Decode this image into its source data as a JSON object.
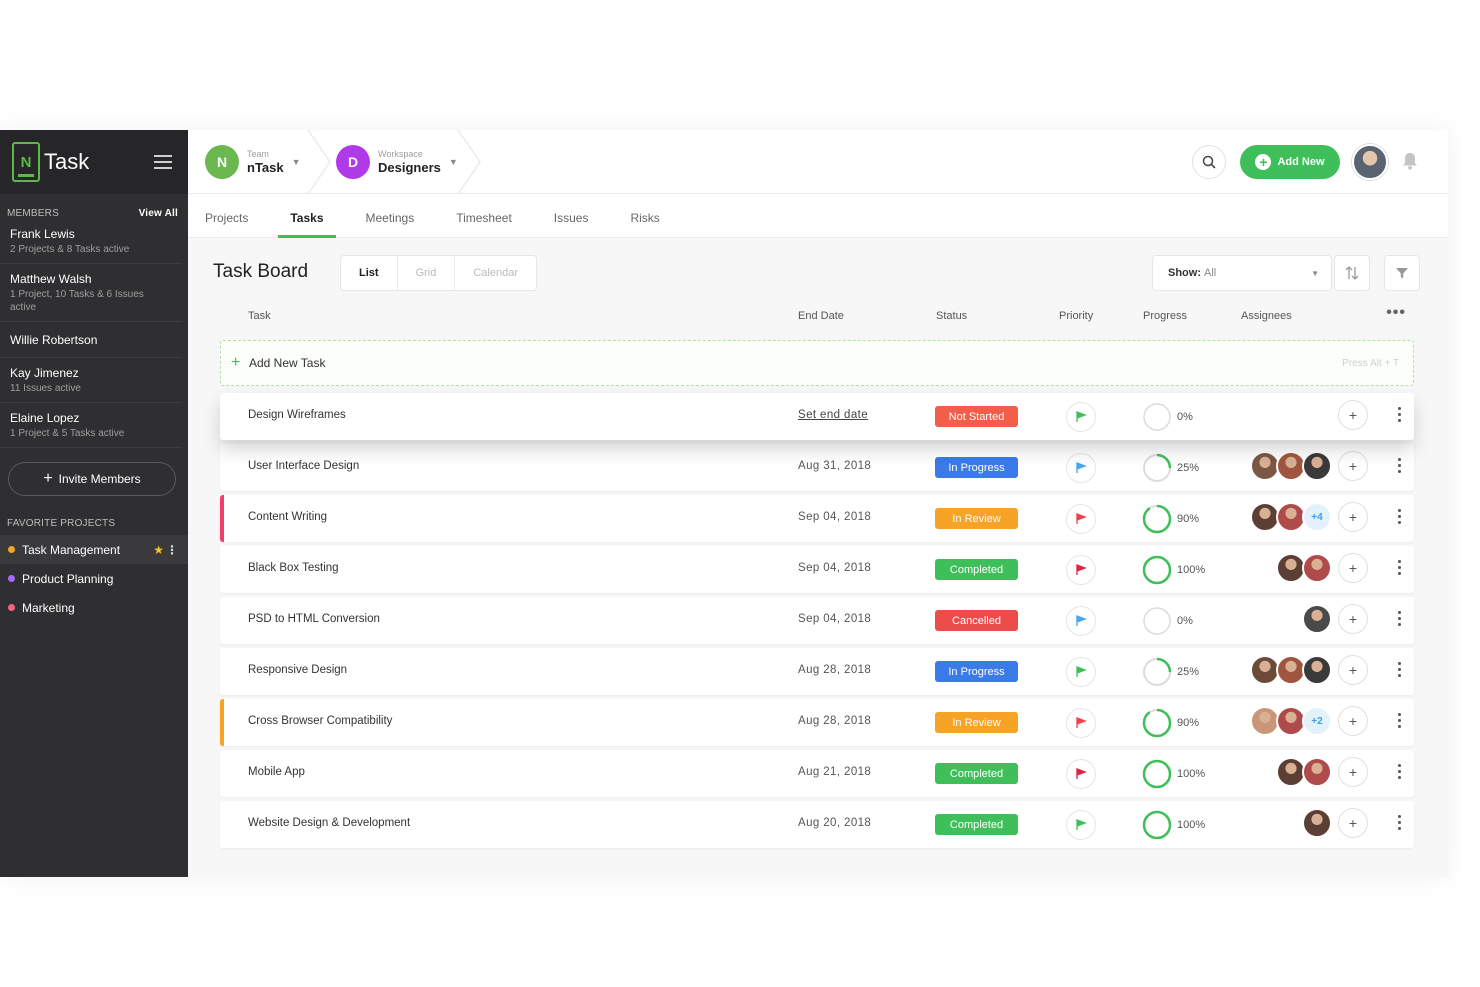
{
  "app": {
    "logo_letter": "N",
    "name": "Task"
  },
  "sidebar": {
    "members_label": "MEMBERS",
    "view_all": "View All",
    "members": [
      {
        "name": "Frank Lewis",
        "sub": "2 Projects & 8 Tasks active"
      },
      {
        "name": "Matthew Walsh",
        "sub": "1 Project, 10 Tasks & 6 Issues active"
      },
      {
        "name": "Willie Robertson",
        "sub": ""
      },
      {
        "name": "Kay Jimenez",
        "sub": "11 Issues active"
      },
      {
        "name": "Elaine Lopez",
        "sub": "1 Project & 5 Tasks active"
      }
    ],
    "invite_label": "Invite Members",
    "favorites_label": "FAVORITE PROJECTS",
    "favorites": [
      {
        "label": "Task Management",
        "color": "#f7a325"
      },
      {
        "label": "Product Planning",
        "color": "#a56bf5"
      },
      {
        "label": "Marketing",
        "color": "#ff5f87"
      }
    ]
  },
  "topbar": {
    "team": {
      "label": "Team",
      "value": "nTask",
      "initial": "N",
      "color": "#6ab84f"
    },
    "workspace": {
      "label": "Workspace",
      "value": "Designers",
      "initial": "D",
      "color": "#b039e8"
    },
    "add_new": "Add New"
  },
  "tabs": [
    "Projects",
    "Tasks",
    "Meetings",
    "Timesheet",
    "Issues",
    "Risks"
  ],
  "active_tab": "Tasks",
  "board": {
    "title": "Task Board",
    "views": [
      "List",
      "Grid",
      "Calendar"
    ],
    "show_label": "Show:",
    "show_value": "All"
  },
  "columns": {
    "task": "Task",
    "end_date": "End Date",
    "status": "Status",
    "priority": "Priority",
    "progress": "Progress",
    "assignees": "Assignees"
  },
  "add_task": {
    "label": "Add New Task",
    "hint": "Press Alt + T"
  },
  "status_colors": {
    "Not Started": "#f25e49",
    "In Progress": "#3b7be8",
    "In Review": "#f7a325",
    "Completed": "#3fbf5a",
    "Cancelled": "#ee4b4b"
  },
  "tasks": [
    {
      "name": "Design Wireframes",
      "end_date": "Set end date",
      "status": "Not Started",
      "priority_color": "#3fbf5a",
      "progress": 0,
      "progress_label": "0%",
      "assignees": [],
      "more": "",
      "bar": ""
    },
    {
      "name": "User Interface Design",
      "end_date": "Aug 31, 2018",
      "status": "In Progress",
      "priority_color": "#45a8f0",
      "progress": 25,
      "progress_label": "25%",
      "assignees": [
        "#7a5845",
        "#a0563e",
        "#3a3a3a"
      ],
      "more": "",
      "bar": ""
    },
    {
      "name": "Content Writing",
      "end_date": "Sep 04, 2018",
      "status": "In Review",
      "priority_color": "#f2404f",
      "progress": 90,
      "progress_label": "90%",
      "assignees": [
        "#5b3f35",
        "#b04b4b"
      ],
      "more": "+4",
      "bar": "#ee3f6b"
    },
    {
      "name": "Black Box Testing",
      "end_date": "Sep 04, 2018",
      "status": "Completed",
      "priority_color": "#e1243f",
      "progress": 100,
      "progress_label": "100%",
      "assignees": [
        "#5b3f35",
        "#b04b4b"
      ],
      "more": "",
      "bar": ""
    },
    {
      "name": "PSD to HTML Conversion",
      "end_date": "Sep 04, 2018",
      "status": "Cancelled",
      "priority_color": "#45a8f0",
      "progress": 0,
      "progress_label": "0%",
      "assignees": [
        "#4a4a4a"
      ],
      "more": "",
      "bar": ""
    },
    {
      "name": "Responsive Design",
      "end_date": "Aug 28, 2018",
      "status": "In Progress",
      "priority_color": "#3fbf5a",
      "progress": 25,
      "progress_label": "25%",
      "assignees": [
        "#6b4a3a",
        "#a0563e",
        "#3a3a3a"
      ],
      "more": "",
      "bar": ""
    },
    {
      "name": "Cross Browser Compatibility",
      "end_date": "Aug 28, 2018",
      "status": "In Review",
      "priority_color": "#f2404f",
      "progress": 90,
      "progress_label": "90%",
      "assignees": [
        "#c99678",
        "#b04b4b"
      ],
      "more": "+2",
      "bar": "#f7a325"
    },
    {
      "name": "Mobile App",
      "end_date": "Aug 21, 2018",
      "status": "Completed",
      "priority_color": "#e1243f",
      "progress": 100,
      "progress_label": "100%",
      "assignees": [
        "#5b3f35",
        "#b04b4b"
      ],
      "more": "",
      "bar": ""
    },
    {
      "name": "Website Design & Development",
      "end_date": "Aug 20, 2018",
      "status": "Completed",
      "priority_color": "#3fbf5a",
      "progress": 100,
      "progress_label": "100%",
      "assignees": [
        "#5b3f35"
      ],
      "more": "",
      "bar": ""
    }
  ]
}
